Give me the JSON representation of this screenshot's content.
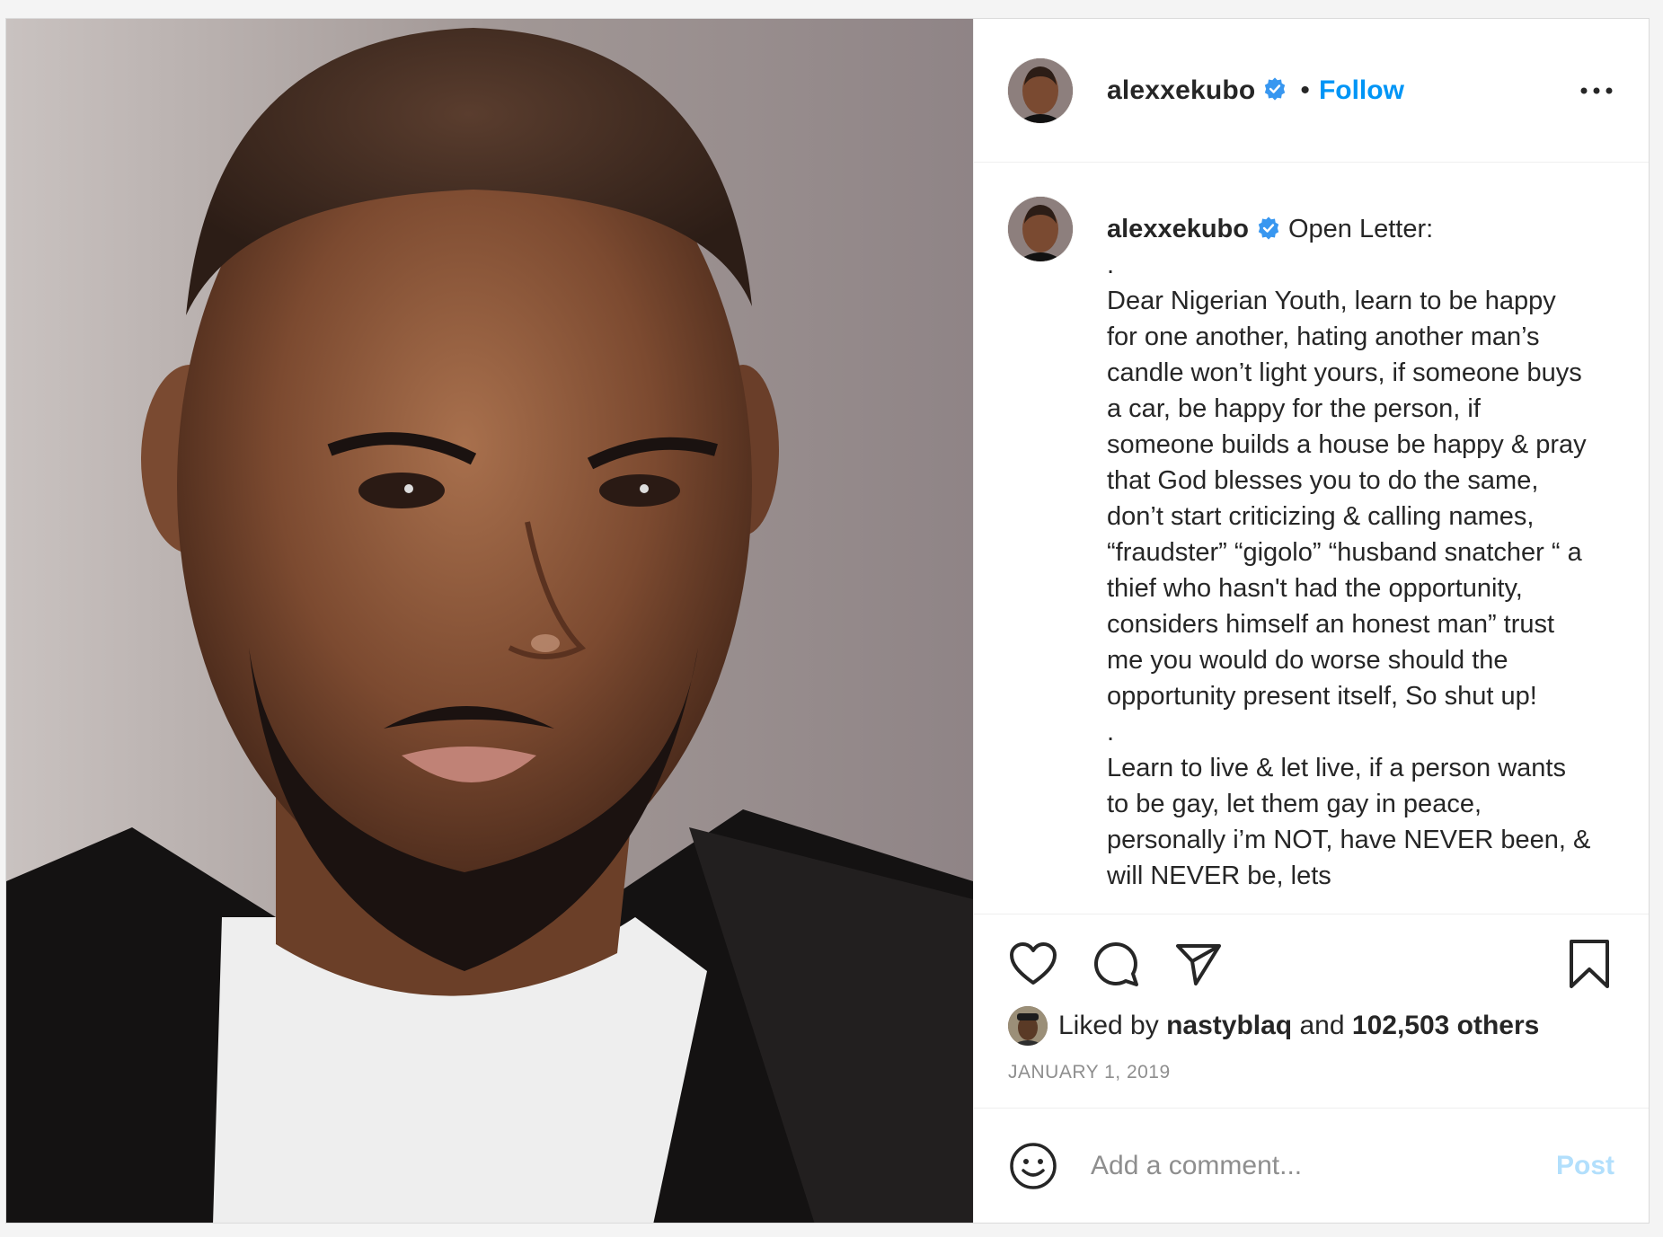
{
  "post": {
    "username": "alexxekubo",
    "separator": "•",
    "follow_label": "Follow",
    "more_icon": "more-horizontal-icon",
    "verified_icon": "verified-badge-icon",
    "caption": {
      "username": "alexxekubo",
      "title": "Open Letter:",
      "paragraphs": [
        ".",
        "Dear Nigerian Youth, learn to be happy for one another, hating another man’s candle won’t light yours, if someone buys a car, be happy for the person, if someone builds a house be happy & pray that God blesses you to do the same, don’t start criticizing & calling names, “fraudster” “gigolo” “husband snatcher “ a thief who hasn't had the opportunity, considers himself an honest man” trust me you would do worse should the opportunity present itself, So shut up!",
        ".",
        "Learn to live & let live, if a person wants to be gay, let them gay in peace, personally i’m NOT, have NEVER been, & will NEVER be, lets"
      ]
    },
    "icons": {
      "like": "heart-icon",
      "comment": "comment-icon",
      "share": "share-icon",
      "save": "bookmark-icon",
      "emoji": "emoji-icon"
    },
    "likes": {
      "prefix": "Liked by",
      "user": "nastyblaq",
      "conjunction": "and",
      "others": "102,503 others"
    },
    "date": "JANUARY 1, 2019",
    "comment": {
      "placeholder": "Add a comment...",
      "post_label": "Post"
    },
    "colors": {
      "accent": "#0095f6",
      "post_disabled": "#b2dffc",
      "verified": "#3897f0",
      "muted": "#8e8e8e"
    }
  }
}
